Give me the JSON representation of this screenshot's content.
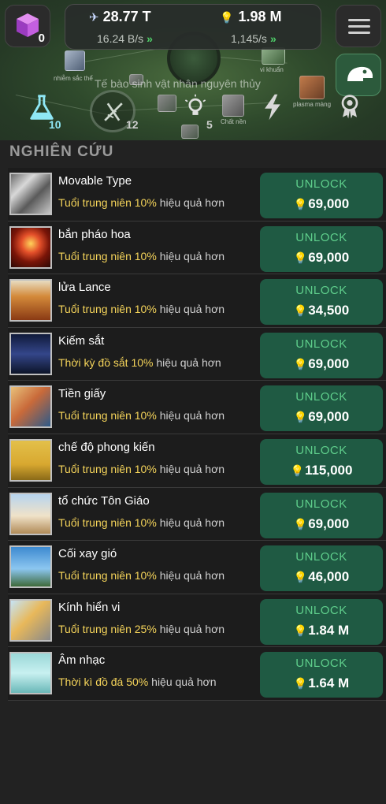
{
  "header": {
    "cube_count": "0",
    "power_value": "28.77 T",
    "power_rate": "16.24 B/s",
    "ideas_value": "1.98 M",
    "ideas_rate": "1,145/s",
    "chevrons": "»"
  },
  "map": {
    "era_label": "Tế bào sinh vật nhân nguyên thủy",
    "node_labels": [
      "nhiễm sắc thể",
      "vi khuẩn",
      "plasma màng",
      "Chất nền"
    ]
  },
  "tabs": [
    {
      "icon": "flask-icon",
      "count": "10"
    },
    {
      "icon": "dna-icon",
      "count": "12"
    },
    {
      "icon": "lightbulb-icon",
      "count": "5"
    },
    {
      "icon": "lightning-icon",
      "count": ""
    },
    {
      "icon": "medal-icon",
      "count": ""
    }
  ],
  "section_title": "NGHIÊN CỨU",
  "unlock_label": "UNLOCK",
  "research": [
    {
      "name": "Movable Type",
      "era": "Tuổi trung niên",
      "pct": "10%",
      "rest": "hiệu quả hơn",
      "price": "69,000",
      "thumb": "film-icon"
    },
    {
      "name": "bắn pháo hoa",
      "era": "Tuổi trung niên",
      "pct": "10%",
      "rest": "hiệu quả hơn",
      "price": "69,000",
      "thumb": "fireworks-icon"
    },
    {
      "name": "lửa Lance",
      "era": "Tuổi trung niên",
      "pct": "10%",
      "rest": "hiệu quả hơn",
      "price": "34,500",
      "thumb": "fire-lance-icon"
    },
    {
      "name": "Kiếm sắt",
      "era": "Thời kỳ đồ sắt",
      "pct": "10%",
      "rest": "hiệu quả hơn",
      "price": "69,000",
      "thumb": "sword-icon"
    },
    {
      "name": "Tiền giấy",
      "era": "Tuổi trung niên",
      "pct": "10%",
      "rest": "hiệu quả hơn",
      "price": "69,000",
      "thumb": "banknote-icon"
    },
    {
      "name": "chế độ phong kiến",
      "era": "Tuổi trung niên",
      "pct": "10%",
      "rest": "hiệu quả hơn",
      "price": "115,000",
      "thumb": "feudal-icon"
    },
    {
      "name": "tổ chức Tôn Giáo",
      "era": "Tuổi trung niên",
      "pct": "10%",
      "rest": "hiệu quả hơn",
      "price": "69,000",
      "thumb": "mosque-icon"
    },
    {
      "name": "Cối xay gió",
      "era": "Tuổi trung niên",
      "pct": "10%",
      "rest": "hiệu quả hơn",
      "price": "46,000",
      "thumb": "windmill-icon"
    },
    {
      "name": "Kính hiển vi",
      "era": "Tuổi trung niên",
      "pct": "25%",
      "rest": "hiệu quả hơn",
      "price": "1.84 M",
      "thumb": "microscope-icon"
    },
    {
      "name": "Âm nhạc",
      "era": "Thời kì đồ đá",
      "pct": "50%",
      "rest": "hiệu quả hơn",
      "price": "1.64 M",
      "thumb": "flute-icon"
    }
  ],
  "colors": {
    "accent_green": "#1f5a43",
    "unlock_text": "#5fcf8c",
    "highlight_yellow": "#f5d45a",
    "chevron_green": "#4fd06a"
  }
}
